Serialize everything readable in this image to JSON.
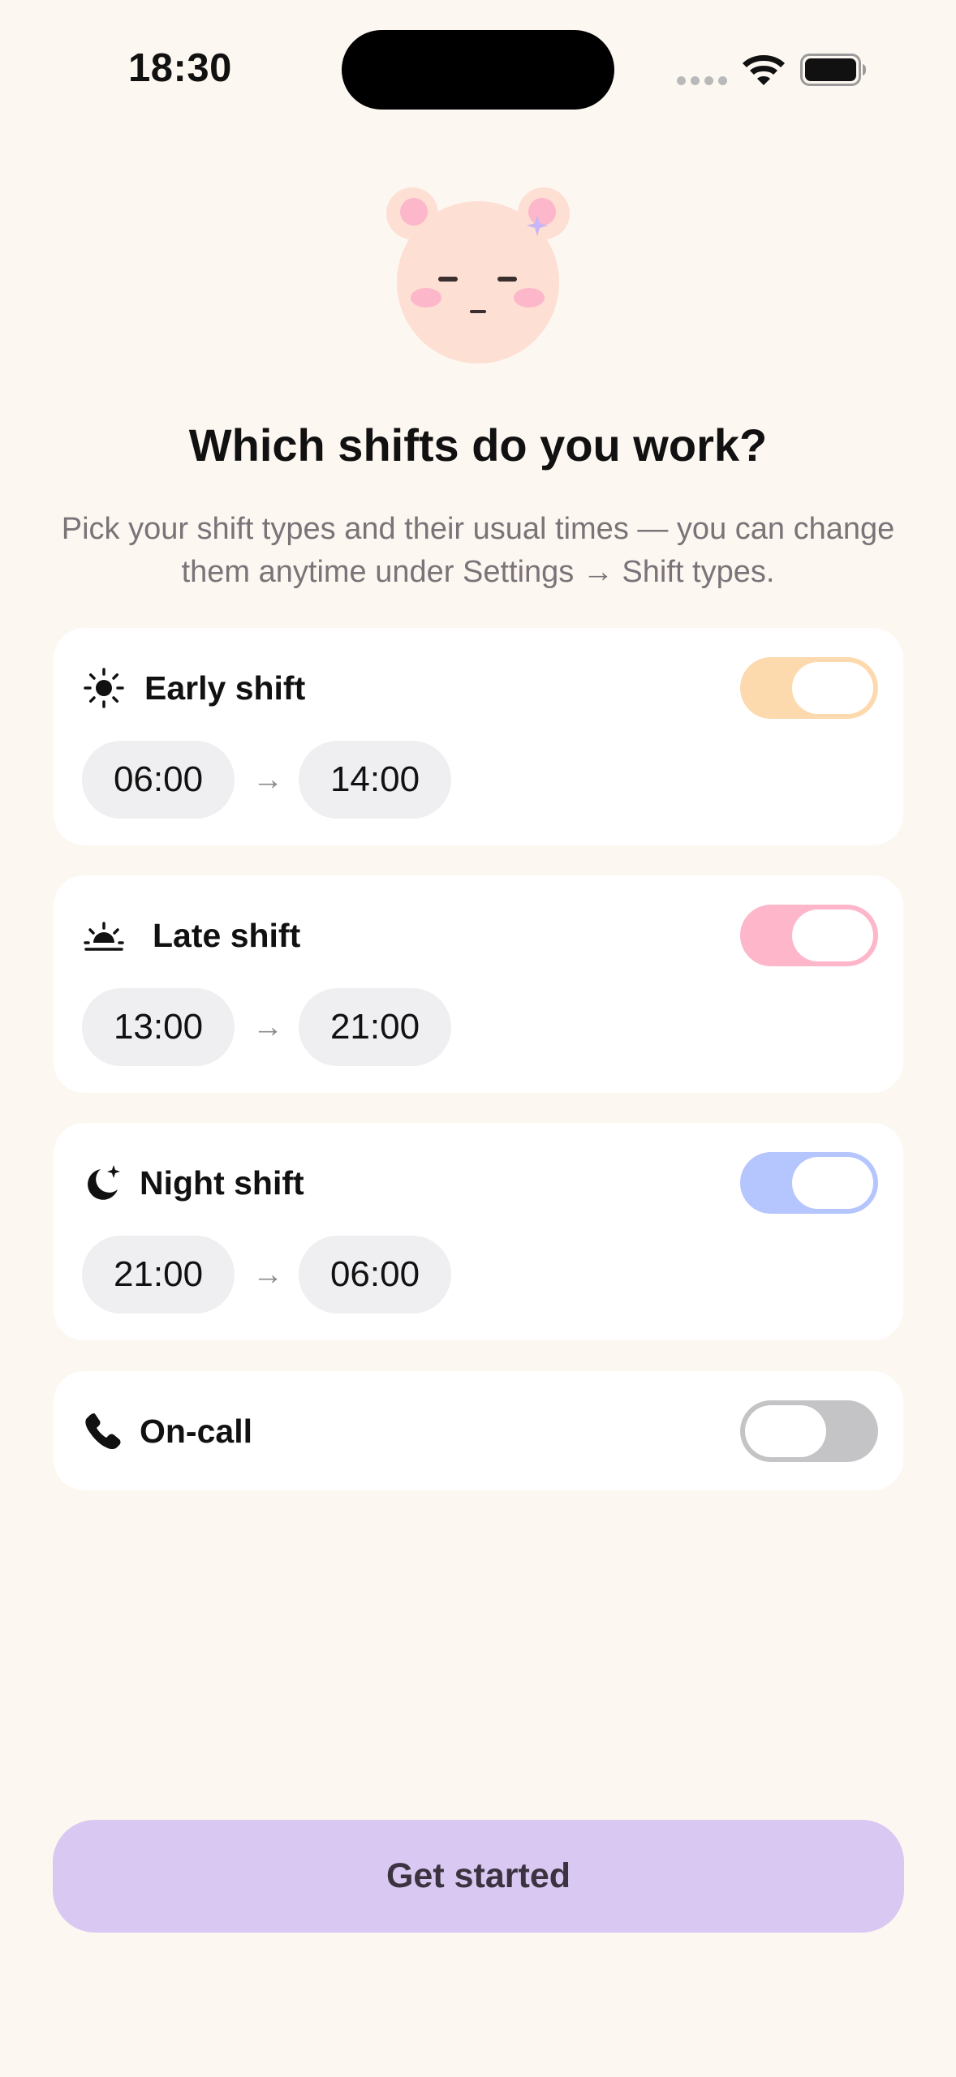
{
  "status_bar": {
    "time": "18:30",
    "icons": [
      "signal-dots-icon",
      "wifi-icon",
      "battery-icon"
    ]
  },
  "mascot": {
    "icon": "bear-face-icon"
  },
  "header": {
    "title": "Which shifts do you work?",
    "subtitle": "Pick your shift types and their usual times — you can change them anytime under Settings → Shift types."
  },
  "shifts": [
    {
      "label": "Early shift",
      "icon": "sun-icon",
      "enabled": true,
      "toggle_color": "#FDD9AE",
      "start": "06:00",
      "arrow": "→",
      "end": "14:00"
    },
    {
      "label": "Late shift",
      "icon": "sunset-icon",
      "enabled": true,
      "toggle_color": "#FDB6CA",
      "start": "13:00",
      "arrow": "→",
      "end": "21:00"
    },
    {
      "label": "Night shift",
      "icon": "moon-stars-icon",
      "enabled": true,
      "toggle_color": "#B5C5FD",
      "start": "21:00",
      "arrow": "→",
      "end": "06:00"
    },
    {
      "label": "On-call",
      "icon": "phone-icon",
      "enabled": false,
      "toggle_color": "#C4C4C6"
    }
  ],
  "footer": {
    "cta_label": "Get started",
    "cta_color": "#D9C8F2"
  }
}
